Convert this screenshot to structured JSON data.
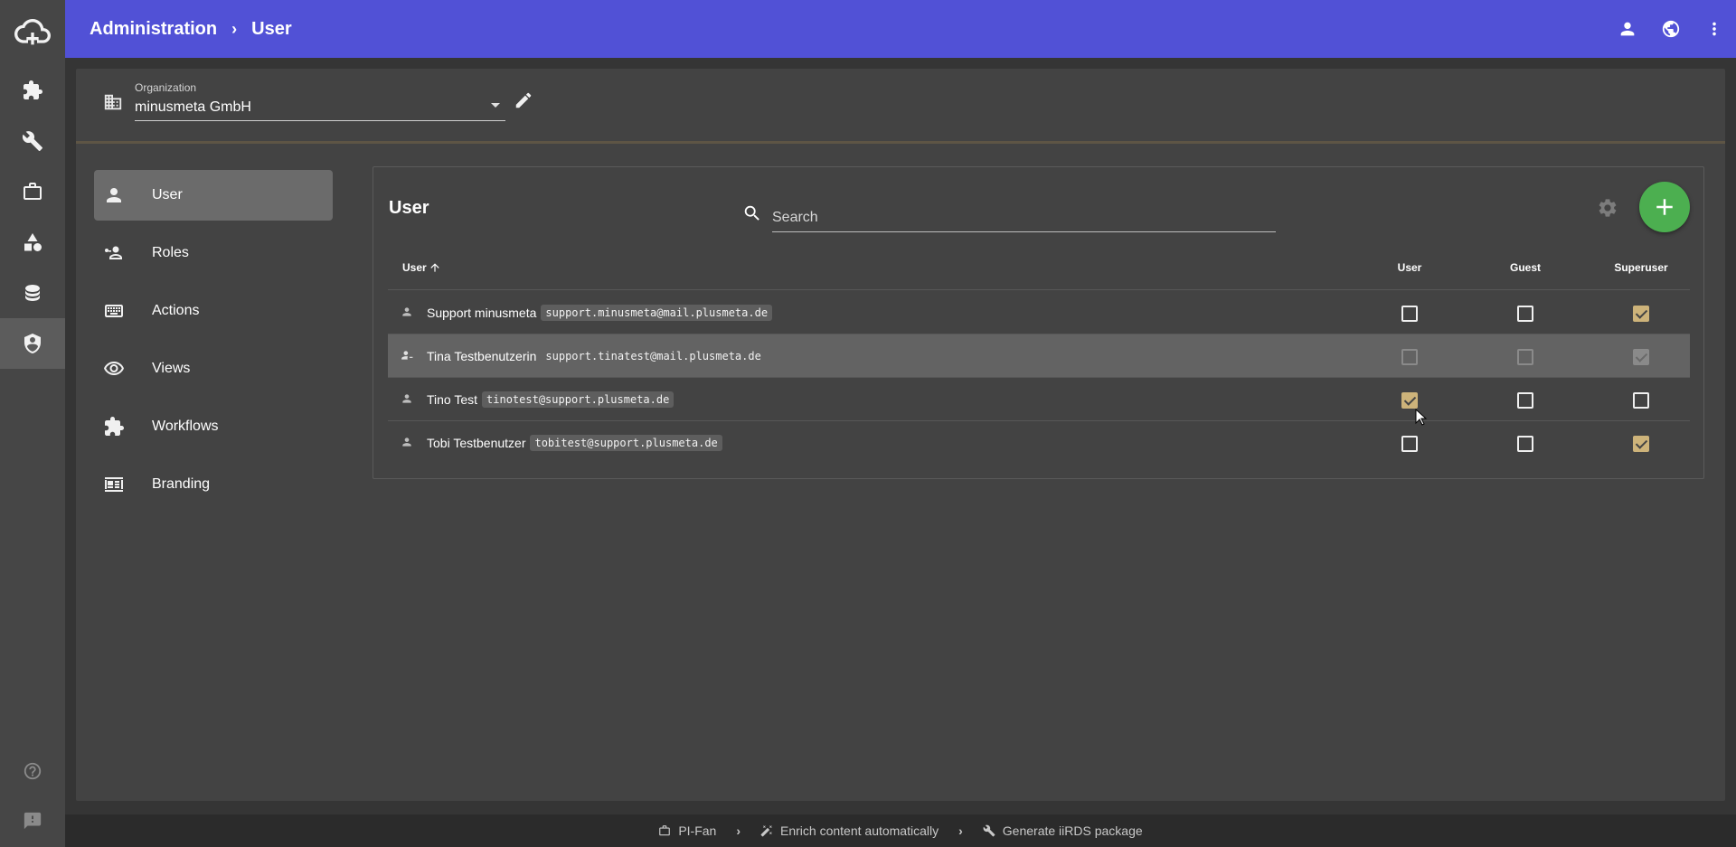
{
  "header": {
    "breadcrumb": [
      "Administration",
      "User"
    ],
    "icons": [
      "account-icon",
      "language-icon",
      "more-vert-icon"
    ]
  },
  "rail": {
    "icons": [
      "cloud-plus-logo",
      "extension-icon",
      "wrench-icon",
      "briefcase-icon",
      "shapes-icon",
      "database-icon",
      "shield-account-icon",
      "help-icon",
      "feedback-icon"
    ],
    "active": "shield-account-icon"
  },
  "organization": {
    "label": "Organization",
    "value": "minusmeta GmbH"
  },
  "nav": {
    "items": [
      {
        "label": "User",
        "icon": "person-icon",
        "active": true
      },
      {
        "label": "Roles",
        "icon": "roles-icon",
        "active": false
      },
      {
        "label": "Actions",
        "icon": "keyboard-icon",
        "active": false
      },
      {
        "label": "Views",
        "icon": "eye-icon",
        "active": false
      },
      {
        "label": "Workflows",
        "icon": "extension-icon",
        "active": false
      },
      {
        "label": "Branding",
        "icon": "branding-icon",
        "active": false
      }
    ]
  },
  "user_panel": {
    "title": "User",
    "search_placeholder": "Search",
    "columns": {
      "user": "User",
      "user_role": "User",
      "guest": "Guest",
      "superuser": "Superuser"
    },
    "sort": "ascending",
    "rows": [
      {
        "name": "Support minusmeta",
        "email": "support.minusmeta@mail.plusmeta.de",
        "user": false,
        "guest": false,
        "superuser": true,
        "disabled": false
      },
      {
        "name": "Tina Testbenutzerin",
        "email": "support.tinatest@mail.plusmeta.de",
        "user": false,
        "guest": false,
        "superuser": true,
        "disabled": true
      },
      {
        "name": "Tino Test",
        "email": "tinotest@support.plusmeta.de",
        "user": true,
        "guest": false,
        "superuser": false,
        "disabled": false
      },
      {
        "name": "Tobi Testbenutzer",
        "email": "tobitest@support.plusmeta.de",
        "user": false,
        "guest": false,
        "superuser": true,
        "disabled": false
      }
    ]
  },
  "footer": {
    "items": [
      "PI-Fan",
      "Enrich content automatically",
      "Generate iiRDS package"
    ]
  },
  "colors": {
    "topbar": "#5151d6",
    "fab": "#4caf50",
    "checked": "#cdb37a"
  }
}
